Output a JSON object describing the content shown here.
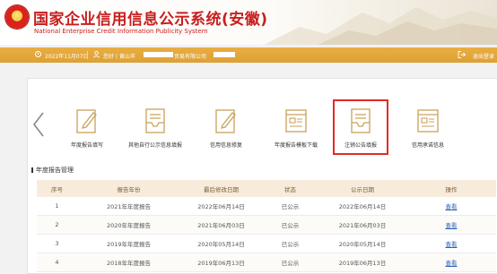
{
  "header": {
    "title": "国家企业信用信息公示系统(安徽)",
    "subtitle": "National Enterprise Credit Information Publicity System",
    "emblem_icon": "national-emblem-icon"
  },
  "infobar": {
    "date": "2022年11月07日",
    "greeting": "您好丨黄山市",
    "company_suffix": "贸易有限公司",
    "logout": "退出登录",
    "background_color": "#e2a63c"
  },
  "functions": [
    {
      "label": "年度报告填写",
      "icon": "edit-doc-icon"
    },
    {
      "label": "其他自行公示信息填报",
      "icon": "inbox-icon"
    },
    {
      "label": "信用信息修复",
      "icon": "edit-doc-icon"
    },
    {
      "label": "年度报告模板下载",
      "icon": "template-icon"
    },
    {
      "label": "注销公告填报",
      "icon": "inbox-icon"
    },
    {
      "label": "信用承诺信息",
      "icon": "template-icon"
    }
  ],
  "section_title": "年度报告管理",
  "table": {
    "headers": [
      "序号",
      "报告年份",
      "最后修改日期",
      "状态",
      "公示日期",
      "操作"
    ],
    "rows": [
      [
        "1",
        "2021年年度报告",
        "2022年06月14日",
        "已公示",
        "2022年06月14日",
        "查看"
      ],
      [
        "2",
        "2020年年度报告",
        "2021年06月03日",
        "已公示",
        "2021年06月03日",
        "查看"
      ],
      [
        "3",
        "2019年年度报告",
        "2020年05月14日",
        "已公示",
        "2020年05月14日",
        "查看"
      ],
      [
        "4",
        "2018年年度报告",
        "2019年06月13日",
        "已公示",
        "2019年06月13日",
        "查看"
      ]
    ]
  },
  "colors": {
    "brand_red": "#c81e1e",
    "icon_gold": "#c9a25a",
    "highlight_red": "#e12b26",
    "link_blue": "#2b5fb5"
  }
}
